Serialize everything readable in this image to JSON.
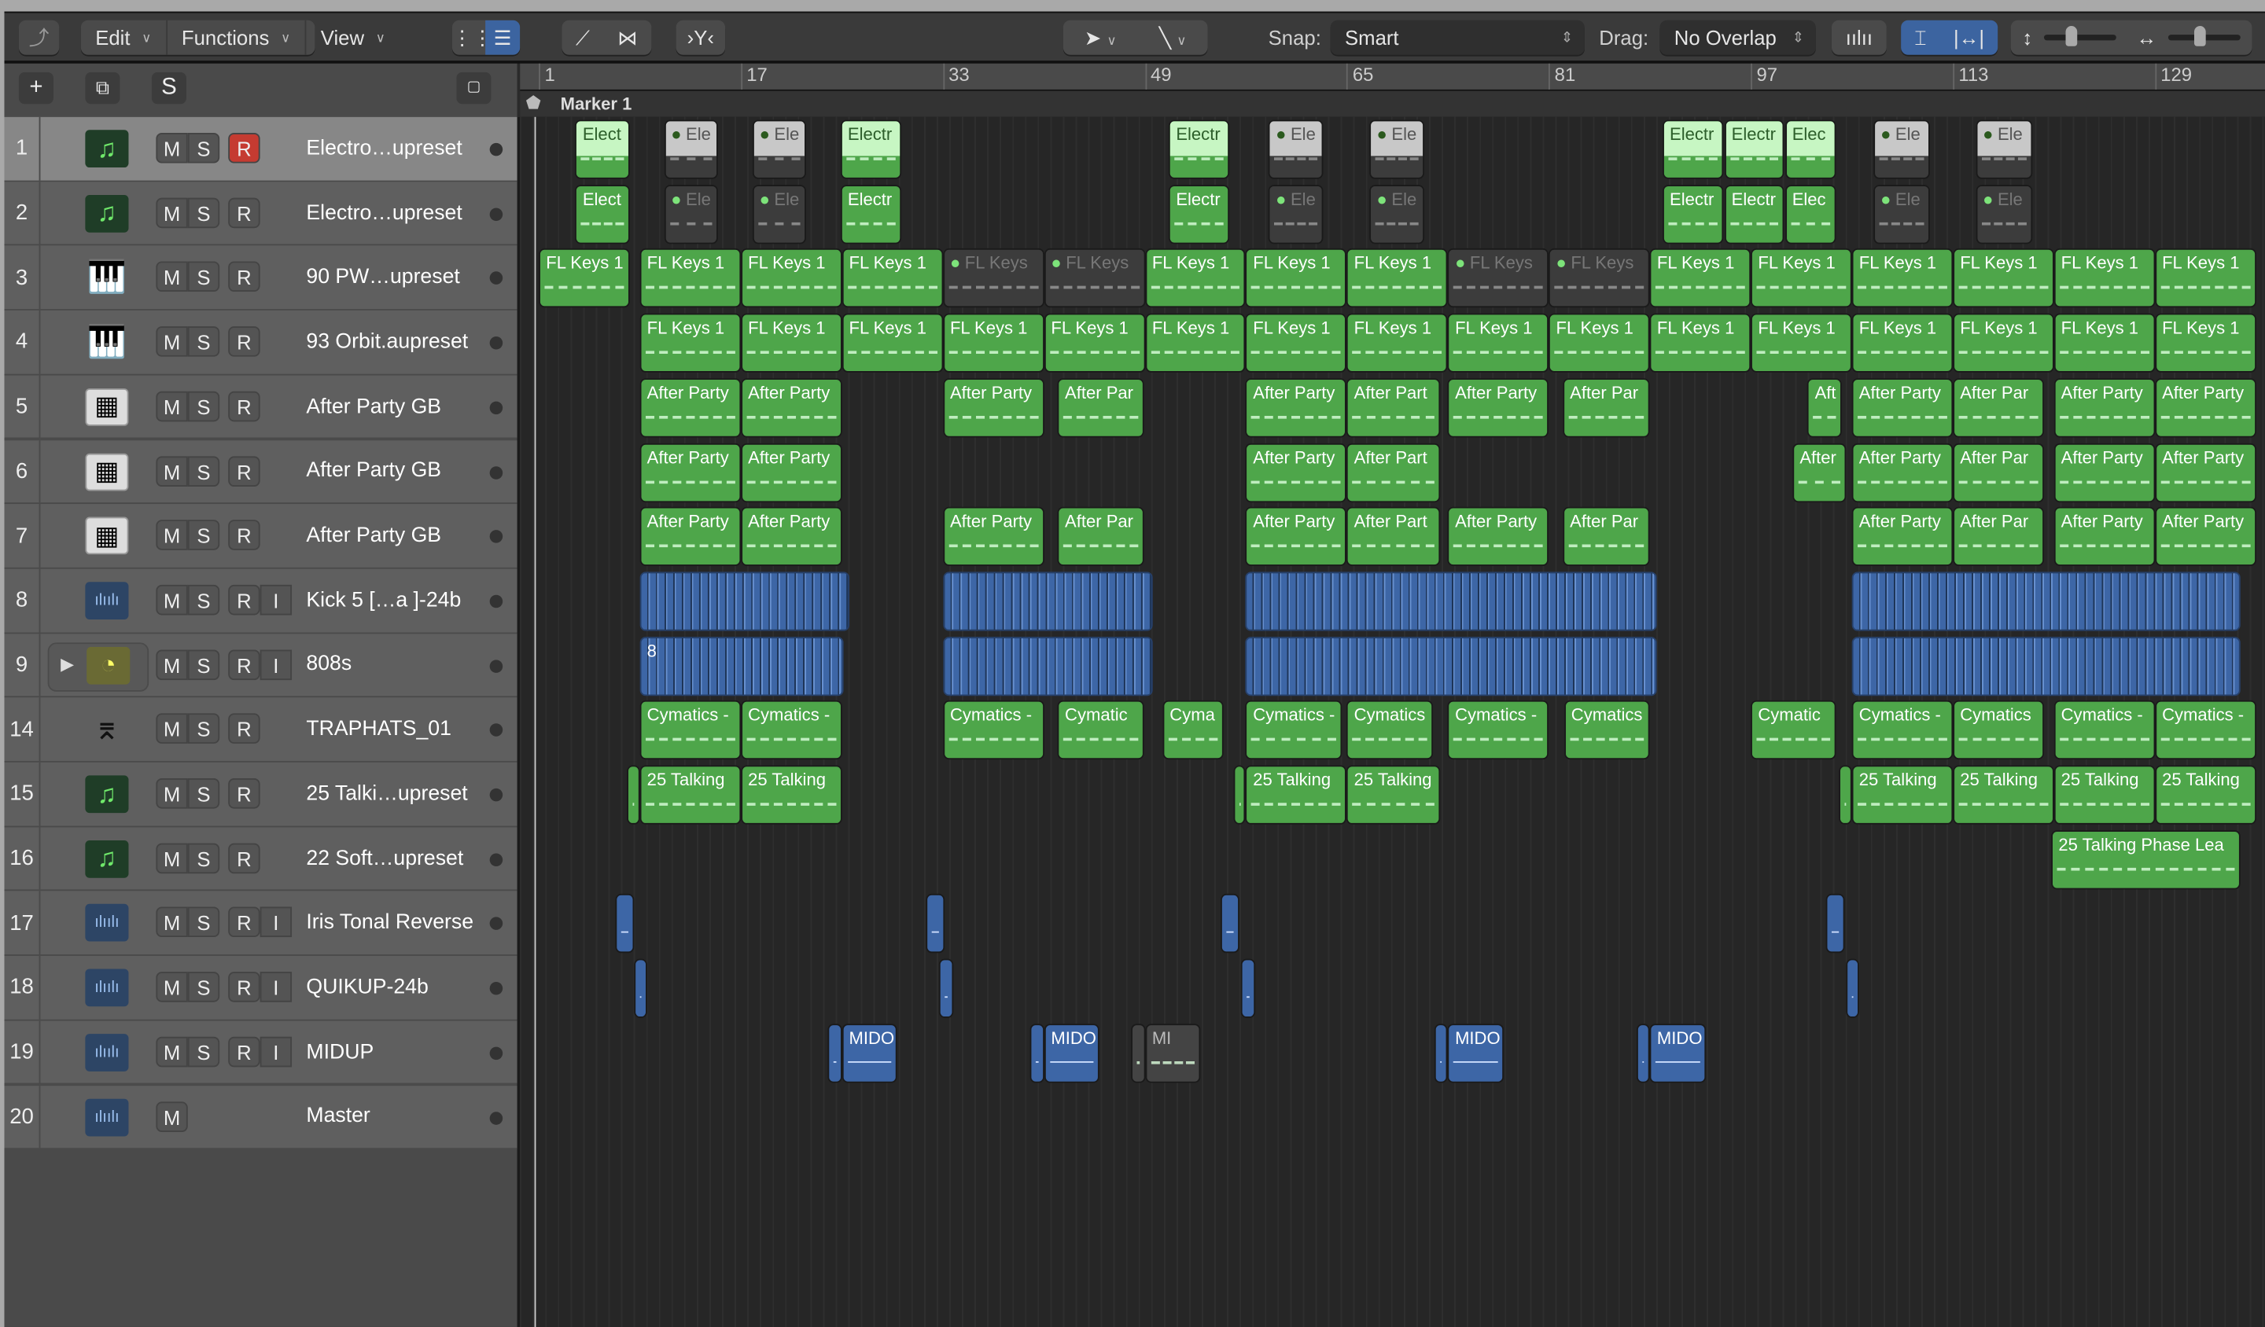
{
  "toolbar": {
    "back_icon": "back-arrow-icon",
    "edit": "Edit",
    "functions": "Functions",
    "view": "View",
    "snap_label": "Snap:",
    "snap_value": "Smart",
    "drag_label": "Drag:",
    "drag_value": "No Overlap"
  },
  "header_buttons": {
    "add": "+",
    "duplicate": "⧉",
    "solo": "S"
  },
  "ruler": {
    "bars": [
      "1",
      "17",
      "33",
      "49",
      "65",
      "81",
      "97",
      "113",
      "129"
    ]
  },
  "marker": "Marker 1",
  "colors": {
    "region_green": "#4ea64a",
    "region_audio": "#3d66a6",
    "record_red": "#c53b31"
  },
  "tracks": [
    {
      "num": "1",
      "name": "Electro…upreset",
      "icon": "note",
      "buttons": [
        "M",
        "S"
      ],
      "rbuttons": [
        "R"
      ],
      "selected": true,
      "rec": true,
      "regions": [
        [
          3.9,
          4.3,
          "Elect",
          "gs"
        ],
        [
          10.9,
          4.3,
          "Ele",
          "m"
        ],
        [
          17.9,
          4.3,
          "Ele",
          "m"
        ],
        [
          24.9,
          4.8,
          "Electr",
          "gs"
        ],
        [
          50.9,
          4.8,
          "Electr",
          "gs"
        ],
        [
          58.8,
          4.3,
          "Ele",
          "m"
        ],
        [
          66.8,
          4.3,
          "Ele",
          "m"
        ],
        [
          90,
          4.8,
          "Electr",
          "gs"
        ],
        [
          94.9,
          4.7,
          "Electr",
          "gs"
        ],
        [
          99.7,
          4,
          "Elec",
          "gs"
        ],
        [
          106.7,
          4.5,
          "Ele",
          "m"
        ],
        [
          114.8,
          4.5,
          "Ele",
          "m"
        ]
      ]
    },
    {
      "num": "2",
      "name": "Electro…upreset",
      "icon": "note",
      "buttons": [
        "M",
        "S"
      ],
      "rbuttons": [
        "R"
      ],
      "regions": [
        [
          3.9,
          4.3,
          "Elect",
          "g"
        ],
        [
          10.9,
          4.3,
          "Ele",
          "m alt"
        ],
        [
          17.9,
          4.3,
          "Ele",
          "m alt"
        ],
        [
          24.9,
          4.8,
          "Electr",
          "g"
        ],
        [
          50.9,
          4.8,
          "Electr",
          "g"
        ],
        [
          58.8,
          4.3,
          "Ele",
          "m alt"
        ],
        [
          66.8,
          4.3,
          "Ele",
          "m alt"
        ],
        [
          90,
          4.8,
          "Electr",
          "g"
        ],
        [
          94.9,
          4.7,
          "Electr",
          "g"
        ],
        [
          99.7,
          4,
          "Elec",
          "g"
        ],
        [
          106.7,
          4.5,
          "Ele",
          "m alt"
        ],
        [
          114.8,
          4.5,
          "Ele",
          "m alt"
        ]
      ]
    },
    {
      "num": "3",
      "name": "90 PW…upreset",
      "icon": "piano",
      "buttons": [
        "M",
        "S"
      ],
      "rbuttons": [
        "R"
      ],
      "regions": [
        [
          1,
          7.2,
          "FL Keys 1",
          "g"
        ],
        [
          9,
          8,
          "FL Keys 1",
          "g"
        ],
        [
          17,
          8,
          "FL Keys 1",
          "g"
        ],
        [
          25,
          8,
          "FL Keys 1",
          "g"
        ],
        [
          33,
          8,
          "FL Keys",
          "m alt"
        ],
        [
          41,
          8,
          "FL Keys",
          "m alt"
        ],
        [
          49,
          8,
          "FL Keys 1",
          "g"
        ],
        [
          57,
          8,
          "FL Keys 1",
          "g"
        ],
        [
          65,
          8,
          "FL Keys 1",
          "g"
        ],
        [
          73,
          8,
          "FL Keys",
          "m alt"
        ],
        [
          81,
          8,
          "FL Keys",
          "m alt"
        ],
        [
          89,
          8,
          "FL Keys 1",
          "g"
        ],
        [
          97,
          8,
          "FL Keys 1",
          "g"
        ],
        [
          105,
          8,
          "FL Keys 1",
          "g"
        ],
        [
          113,
          8,
          "FL Keys 1",
          "g"
        ],
        [
          121,
          8,
          "FL Keys 1",
          "g"
        ],
        [
          129,
          8,
          "FL Keys 1",
          "g"
        ]
      ]
    },
    {
      "num": "4",
      "name": "93 Orbit.aupreset",
      "icon": "piano",
      "buttons": [
        "M",
        "S"
      ],
      "rbuttons": [
        "R"
      ],
      "regions": [
        [
          9,
          8,
          "FL Keys 1",
          "g"
        ],
        [
          17,
          8,
          "FL Keys 1",
          "g"
        ],
        [
          25,
          8,
          "FL Keys 1",
          "g"
        ],
        [
          33,
          8,
          "FL Keys 1",
          "g"
        ],
        [
          41,
          8,
          "FL Keys 1",
          "g"
        ],
        [
          49,
          8,
          "FL Keys 1",
          "g"
        ],
        [
          57,
          8,
          "FL Keys 1",
          "g"
        ],
        [
          65,
          8,
          "FL Keys 1",
          "g"
        ],
        [
          73,
          8,
          "FL Keys 1",
          "g"
        ],
        [
          81,
          8,
          "FL Keys 1",
          "g"
        ],
        [
          89,
          8,
          "FL Keys 1",
          "g"
        ],
        [
          97,
          8,
          "FL Keys 1",
          "g"
        ],
        [
          105,
          8,
          "FL Keys 1",
          "g"
        ],
        [
          113,
          8,
          "FL Keys 1",
          "g"
        ],
        [
          121,
          8,
          "FL Keys 1",
          "g"
        ],
        [
          129,
          8,
          "FL Keys 1",
          "g"
        ]
      ]
    },
    {
      "num": "5",
      "name": "After Party GB",
      "icon": "mpc",
      "buttons": [
        "M",
        "S"
      ],
      "rbuttons": [
        "R"
      ],
      "regions": [
        [
          9,
          8,
          "After Party",
          "g"
        ],
        [
          17,
          8,
          "After Party",
          "g"
        ],
        [
          33,
          8,
          "After Party",
          "g"
        ],
        [
          42.1,
          6.8,
          "After Par",
          "g"
        ],
        [
          57,
          8,
          "After Party",
          "g"
        ],
        [
          65,
          7.4,
          "After Part",
          "g"
        ],
        [
          73,
          8,
          "After Party",
          "g"
        ],
        [
          82.1,
          6.9,
          "After Par",
          "g"
        ],
        [
          101.5,
          2.7,
          "Aft",
          "g"
        ],
        [
          105,
          8,
          "After Party",
          "g"
        ],
        [
          113,
          7.2,
          "After Par",
          "g"
        ],
        [
          121,
          8,
          "After Party",
          "g"
        ],
        [
          129,
          8,
          "After Party",
          "g"
        ]
      ]
    },
    {
      "num": "6",
      "name": "After Party GB",
      "icon": "mpc",
      "buttons": [
        "M",
        "S"
      ],
      "rbuttons": [
        "R"
      ],
      "regions": [
        [
          9,
          8,
          "After Party",
          "g"
        ],
        [
          17,
          8,
          "After Party",
          "g"
        ],
        [
          57,
          8,
          "After Party",
          "g"
        ],
        [
          65,
          7.4,
          "After Part",
          "g"
        ],
        [
          100.3,
          4.3,
          "After",
          "g"
        ],
        [
          105,
          8,
          "After Party",
          "g"
        ],
        [
          113,
          7.2,
          "After Par",
          "g"
        ],
        [
          121,
          8,
          "After Party",
          "g"
        ],
        [
          129,
          8,
          "After Party",
          "g"
        ]
      ]
    },
    {
      "num": "7",
      "name": "After Party GB",
      "icon": "mpc",
      "buttons": [
        "M",
        "S"
      ],
      "rbuttons": [
        "R"
      ],
      "regions": [
        [
          9,
          8,
          "After Party",
          "g"
        ],
        [
          17,
          8,
          "After Party",
          "g"
        ],
        [
          33,
          8,
          "After Party",
          "g"
        ],
        [
          42.1,
          6.8,
          "After Par",
          "g"
        ],
        [
          57,
          8,
          "After Party",
          "g"
        ],
        [
          65,
          7.4,
          "After Part",
          "g"
        ],
        [
          73,
          8,
          "After Party",
          "g"
        ],
        [
          82.1,
          6.9,
          "After Par",
          "g"
        ],
        [
          105,
          8,
          "After Party",
          "g"
        ],
        [
          113,
          7.2,
          "After Par",
          "g"
        ],
        [
          121,
          8,
          "After Party",
          "g"
        ],
        [
          129,
          8,
          "After Party",
          "g"
        ]
      ]
    },
    {
      "num": "8",
      "name": "Kick 5 […a ]-24b",
      "icon": "wave",
      "buttons": [
        "M",
        "S"
      ],
      "rbuttons": [
        "R",
        "I"
      ],
      "regions": [
        [
          9,
          16.6,
          "",
          "b"
        ],
        [
          33,
          16.6,
          "",
          "b"
        ],
        [
          57,
          32.6,
          "",
          "b"
        ],
        [
          105,
          30.8,
          "",
          "b"
        ]
      ]
    },
    {
      "num": "9",
      "name": "808s",
      "icon": "clock",
      "disclosure": true,
      "buttons": [
        "M",
        "S"
      ],
      "rbuttons": [
        "R",
        "I"
      ],
      "regions": [
        [
          9,
          16.1,
          "8",
          "b"
        ],
        [
          33,
          16.6,
          "",
          "b"
        ],
        [
          57,
          32.6,
          "",
          "b"
        ],
        [
          105,
          30.8,
          "",
          "b"
        ]
      ]
    },
    {
      "num": "14",
      "name": "TRAPHATS_01",
      "icon": "stand",
      "buttons": [
        "M",
        "S"
      ],
      "rbuttons": [
        "R"
      ],
      "regions": [
        [
          9,
          8,
          "Cymatics -",
          "g"
        ],
        [
          17,
          8,
          "Cymatics -",
          "g"
        ],
        [
          33,
          8,
          "Cymatics -",
          "g"
        ],
        [
          42.1,
          6.8,
          "Cymatic",
          "g"
        ],
        [
          50.4,
          4.8,
          "Cyma",
          "g"
        ],
        [
          57,
          7.6,
          "Cymatics -",
          "g"
        ],
        [
          65,
          6.8,
          "Cymatics",
          "g"
        ],
        [
          73,
          8,
          "Cymatics -",
          "g"
        ],
        [
          82.2,
          6.8,
          "Cymatics",
          "g"
        ],
        [
          97,
          6.8,
          "Cymatic",
          "g"
        ],
        [
          105,
          8,
          "Cymatics -",
          "g"
        ],
        [
          113,
          7.2,
          "Cymatics",
          "g"
        ],
        [
          121,
          8,
          "Cymatics -",
          "g"
        ],
        [
          129,
          8,
          "Cymatics -",
          "g"
        ]
      ]
    },
    {
      "num": "15",
      "name": "25 Talki…upreset",
      "icon": "note",
      "buttons": [
        "M",
        "S"
      ],
      "rbuttons": [
        "R"
      ],
      "regions": [
        [
          8,
          1,
          "",
          "g"
        ],
        [
          9,
          8,
          "25 Talking",
          "g"
        ],
        [
          17,
          8,
          "25 Talking",
          "g"
        ],
        [
          56,
          1,
          "",
          "g"
        ],
        [
          57,
          8,
          "25 Talking",
          "g"
        ],
        [
          65,
          7.4,
          "25 Talking",
          "g"
        ],
        [
          104,
          1,
          "",
          "g"
        ],
        [
          105,
          8,
          "25 Talking",
          "g"
        ],
        [
          113,
          8,
          "25 Talking",
          "g"
        ],
        [
          121,
          8,
          "25 Talking",
          "g"
        ],
        [
          129,
          8,
          "25 Talking",
          "g"
        ]
      ]
    },
    {
      "num": "16",
      "name": "22 Soft…upreset",
      "icon": "note",
      "buttons": [
        "M",
        "S"
      ],
      "rbuttons": [
        "R"
      ],
      "regions": [
        [
          120.8,
          15,
          "25 Talking Phase Lea",
          "g"
        ]
      ]
    },
    {
      "num": "17",
      "name": "Iris Tonal Reverse",
      "icon": "wave",
      "buttons": [
        "M",
        "S"
      ],
      "rbuttons": [
        "R",
        "I"
      ],
      "regions": [
        [
          7.1,
          1.5,
          "",
          "bs"
        ],
        [
          31.7,
          1.5,
          "",
          "bs"
        ],
        [
          55,
          1.5,
          "",
          "bs"
        ],
        [
          102.9,
          1.5,
          "",
          "bs"
        ]
      ]
    },
    {
      "num": "18",
      "name": "QUIKUP-24b",
      "icon": "wave",
      "buttons": [
        "M",
        "S"
      ],
      "rbuttons": [
        "R",
        "I"
      ],
      "regions": [
        [
          8.5,
          1.1,
          "",
          "bs"
        ],
        [
          32.7,
          1.1,
          "",
          "bs"
        ],
        [
          56.6,
          1.1,
          "",
          "bs"
        ],
        [
          104.5,
          1.1,
          "",
          "bs"
        ]
      ]
    },
    {
      "num": "19",
      "name": "MIDUP",
      "icon": "wave",
      "buttons": [
        "M",
        "S"
      ],
      "rbuttons": [
        "R",
        "I"
      ],
      "regions": [
        [
          23.9,
          1.1,
          "",
          "bs"
        ],
        [
          25,
          4.4,
          "MIDO",
          "bs"
        ],
        [
          39.9,
          1.1,
          "",
          "bs"
        ],
        [
          41,
          4.4,
          "MIDO",
          "bs"
        ],
        [
          47.9,
          1.1,
          "",
          "mg"
        ],
        [
          49,
          4.4,
          "MI",
          "mg"
        ],
        [
          71.9,
          1.1,
          "",
          "bs"
        ],
        [
          73,
          4.4,
          "MIDO",
          "bs"
        ],
        [
          87.9,
          1.1,
          "",
          "bs"
        ],
        [
          89,
          4.4,
          "MIDO",
          "bs"
        ]
      ]
    },
    {
      "num": "20",
      "name": "Master",
      "icon": "wave",
      "buttons": [
        "M"
      ],
      "rbuttons": [],
      "regions": []
    }
  ]
}
